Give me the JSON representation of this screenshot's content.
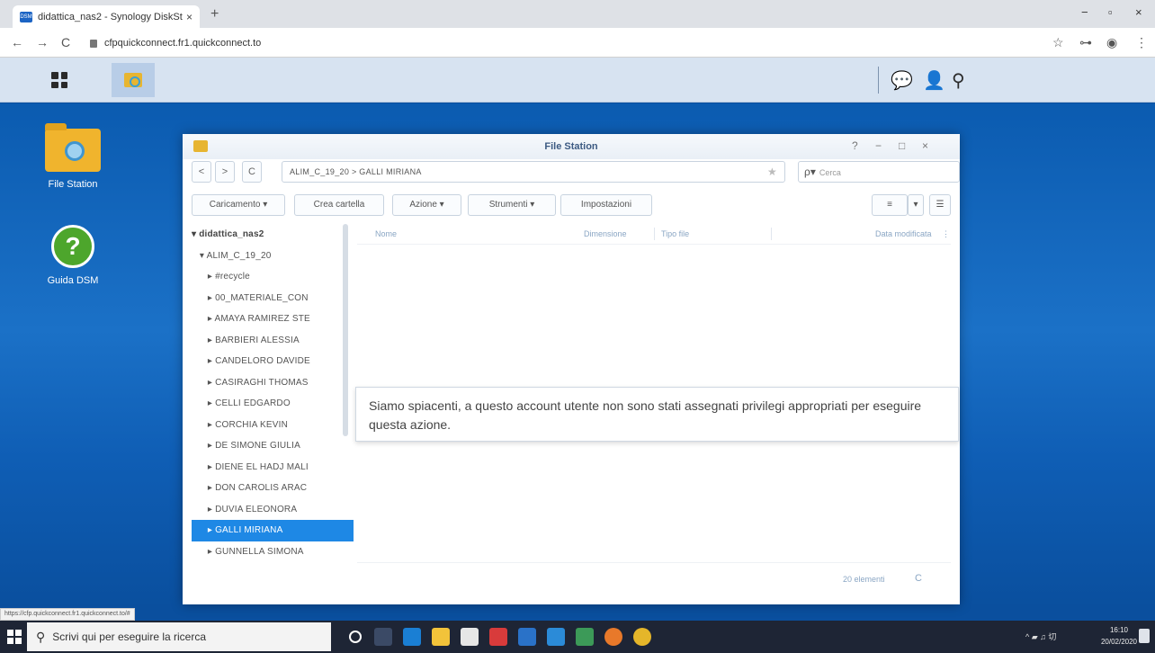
{
  "browser": {
    "tab_title": "didattica_nas2 - Synology DiskSt",
    "tab_close": "×",
    "new_tab": "+",
    "url": "cfpquickconnect.fr1.quickconnect.to",
    "minimize": "−",
    "maximize": "▫",
    "close": "×",
    "back": "←",
    "forward": "→",
    "reload": "C",
    "star": "☆",
    "key": "⊶",
    "profile": "◉",
    "menu": "⋮",
    "status_url": "https://cfp.quickconnect.fr1.quickconnect.to/#"
  },
  "dsm": {
    "chat_icon": "💬",
    "user_icon": "👤",
    "search_icon": "⚲"
  },
  "desktop": {
    "file_station_label": "File Station",
    "help_label": "Guida DSM",
    "help_glyph": "?"
  },
  "file_station": {
    "title": "File Station",
    "help": "?",
    "minimize": "−",
    "maximize": "□",
    "close": "×",
    "back": "<",
    "forward": ">",
    "reload": "C",
    "path": "ALIM_C_19_20 > GALLI MIRIANA",
    "star": "★",
    "search_glyph": "ρ▾",
    "search_placeholder": "Cerca",
    "toolbar": {
      "upload": "Caricamento ▾",
      "new_folder": "Crea cartella",
      "action": "Azione ▾",
      "tools": "Strumenti ▾",
      "settings": "Impostazioni",
      "view_list": "≡",
      "view_dropdown": "▾",
      "sort": "☰"
    },
    "tree": [
      {
        "label": "▾ didattica_nas2",
        "cls": "root"
      },
      {
        "label": "   ▾ ALIM_C_19_20",
        "cls": ""
      },
      {
        "label": "      ▸ #recycle",
        "cls": ""
      },
      {
        "label": "      ▸ 00_MATERIALE_CON",
        "cls": ""
      },
      {
        "label": "      ▸ AMAYA RAMIREZ STE",
        "cls": ""
      },
      {
        "label": "      ▸ BARBIERI ALESSIA",
        "cls": ""
      },
      {
        "label": "      ▸ CANDELORO DAVIDE",
        "cls": ""
      },
      {
        "label": "      ▸ CASIRAGHI THOMAS",
        "cls": ""
      },
      {
        "label": "      ▸ CELLI EDGARDO",
        "cls": ""
      },
      {
        "label": "      ▸ CORCHIA KEVIN",
        "cls": ""
      },
      {
        "label": "      ▸ DE SIMONE GIULIA",
        "cls": ""
      },
      {
        "label": "      ▸ DIENE EL HADJ MALI",
        "cls": ""
      },
      {
        "label": "      ▸ DON CAROLIS ARAC",
        "cls": ""
      },
      {
        "label": "      ▸ DUVIA ELEONORA",
        "cls": ""
      },
      {
        "label": "      ▸ GALLI MIRIANA",
        "cls": "sel"
      },
      {
        "label": "      ▸ GUNNELLA SIMONA",
        "cls": ""
      }
    ],
    "columns": {
      "name": "Nome",
      "size": "Dimensione",
      "type": "Tipo file",
      "modified": "Data modificata",
      "more": "⋮"
    },
    "count": "20 elementi",
    "refresh": "C"
  },
  "toast": {
    "message": "Siamo spiacenti, a questo account utente non sono stati assegnati privilegi appropriati per eseguire questa azione."
  },
  "taskbar": {
    "search_placeholder": "Scrivi qui per eseguire la ricerca",
    "search_glyph": "⚲",
    "time": "16:10",
    "date": "20/02/2020",
    "tray": "^ ▰ ♫ 切"
  }
}
